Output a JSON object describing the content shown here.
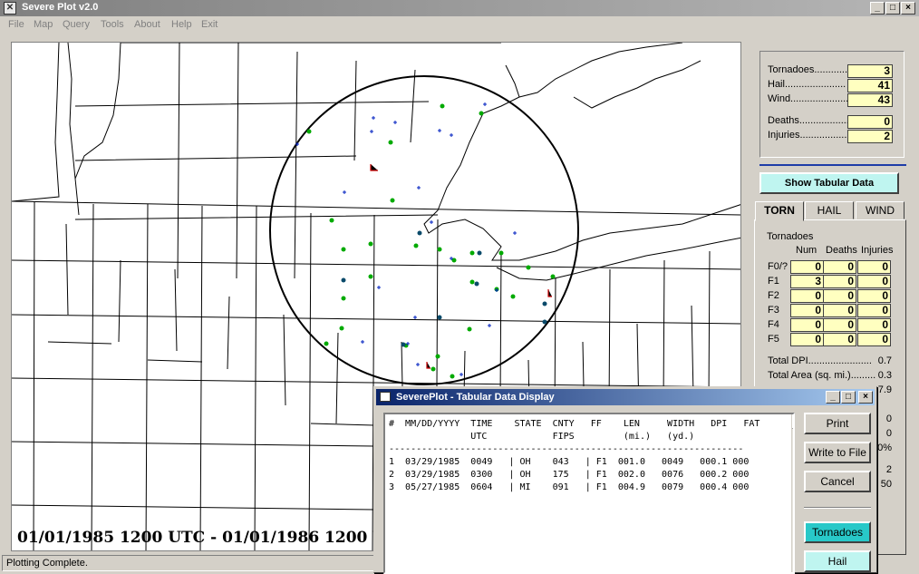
{
  "app": {
    "title": "Severe Plot v2.0"
  },
  "menu": [
    "File",
    "Map",
    "Query",
    "Tools",
    "About",
    "Help",
    "Exit"
  ],
  "map": {
    "date_range": "01/01/1985 1200 UTC - 01/01/1986 1200 UTC"
  },
  "status": "Plotting Complete.",
  "summary": {
    "tornadoes_label": "Tornadoes.............",
    "tornadoes": "3",
    "hail_label": "Hail......................",
    "hail": "41",
    "wind_label": "Wind.....................",
    "wind": "43",
    "deaths_label": "Deaths..................",
    "deaths": "0",
    "injuries_label": "Injuries.................",
    "injuries": "2"
  },
  "show_tabular_label": "Show Tabular Data",
  "tabs": [
    "TORN",
    "HAIL",
    "WIND"
  ],
  "torn": {
    "group_label": "Tornadoes",
    "columns": [
      "Num",
      "Deaths",
      "Injuries"
    ],
    "rows": [
      {
        "label": "F0/?",
        "values": [
          "0",
          "0",
          "0"
        ]
      },
      {
        "label": "F1",
        "values": [
          "3",
          "0",
          "0"
        ]
      },
      {
        "label": "F2",
        "values": [
          "0",
          "0",
          "0"
        ]
      },
      {
        "label": "F3",
        "values": [
          "0",
          "0",
          "0"
        ]
      },
      {
        "label": "F4",
        "values": [
          "0",
          "0",
          "0"
        ]
      },
      {
        "label": "F5",
        "values": [
          "0",
          "0",
          "0"
        ]
      }
    ],
    "total_dpi_label": "Total DPI.......................",
    "total_dpi": "0.7",
    "total_area_label": "Total Area (sq. mi.).........",
    "total_area": "0.3",
    "partial": [
      "7.9",
      "0",
      "0",
      "0%",
      "2",
      "50"
    ]
  },
  "dialog": {
    "title": "SeverePlot - Tabular Data Display",
    "header1": "#  MM/DD/YYYY  TIME    STATE  CNTY   FF    LEN     WIDTH   DPI   FAT",
    "header2": "               UTC            FIPS         (mi.)   (yd.)",
    "divider": "-----------------------------------------------------------------",
    "records": [
      "1  03/29/1985  0049   | OH    043   | F1  001.0   0049   000.1 000",
      "2  03/29/1985  0300   | OH    175   | F1  002.0   0076   000.2 000",
      "3  05/27/1985  0604   | MI    091   | F1  004.9   0079   000.4 000"
    ],
    "buttons": {
      "print": "Print",
      "write": "Write to File",
      "cancel": "Cancel",
      "tornadoes": "Tornadoes",
      "hail": "Hail"
    }
  }
}
